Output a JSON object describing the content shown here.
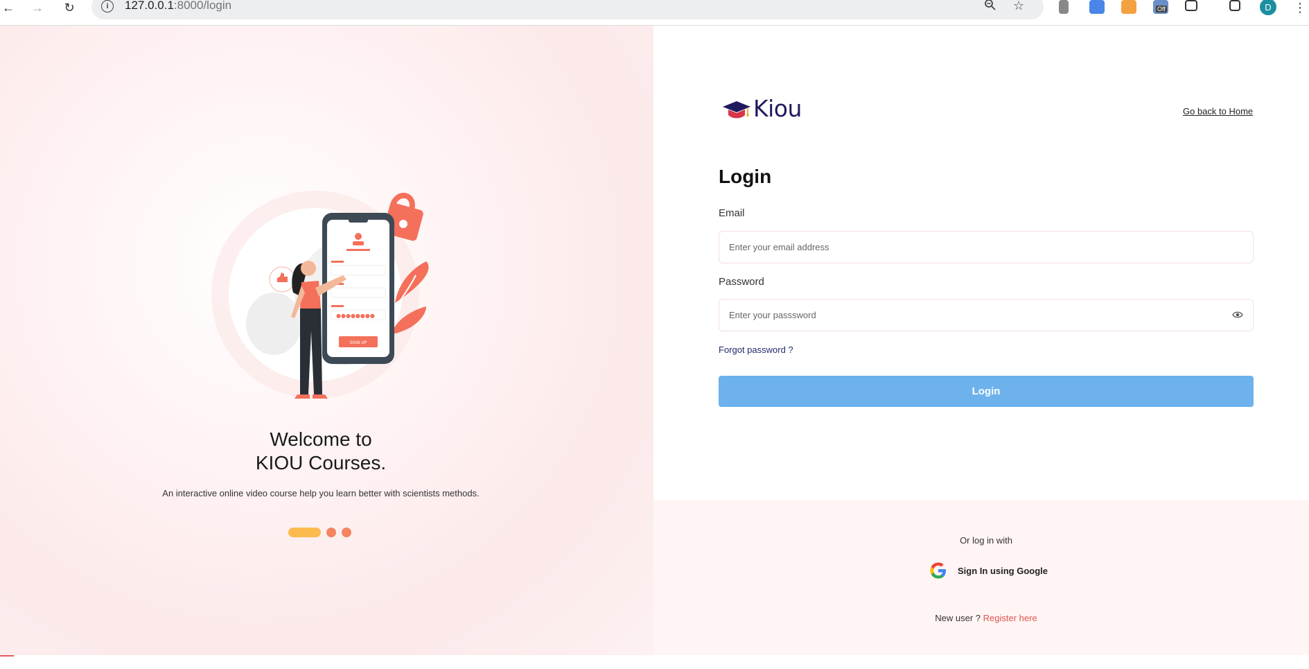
{
  "browser": {
    "url_host": "127.0.0.1",
    "url_path": ":8000/login",
    "extension_badge": "Off",
    "profile_initial": "D"
  },
  "hero": {
    "welcome_line1": "Welcome to",
    "welcome_line2": "KIOU Courses.",
    "tagline": "An interactive online video course help you learn better with scientists methods.",
    "illustration_button_text": "SIGN UP",
    "carousel_active_index": 0,
    "carousel_count": 3
  },
  "brand": {
    "name": "Kiou"
  },
  "nav": {
    "back_home": "Go back to Home"
  },
  "form": {
    "title": "Login",
    "email_label": "Email",
    "email_placeholder": "Enter your email address",
    "password_label": "Password",
    "password_placeholder": "Enter your passsword",
    "forgot": "Forgot password ?",
    "submit": "Login"
  },
  "social": {
    "or_text": "Or log in with",
    "google_label": "Sign In using Google"
  },
  "register": {
    "prompt": "New user ?",
    "link": "Register here"
  },
  "colors": {
    "accent": "#6db2ec",
    "brand_navy": "#1f1a5e",
    "coral": "#f4855f",
    "register_link": "#e0544f"
  }
}
